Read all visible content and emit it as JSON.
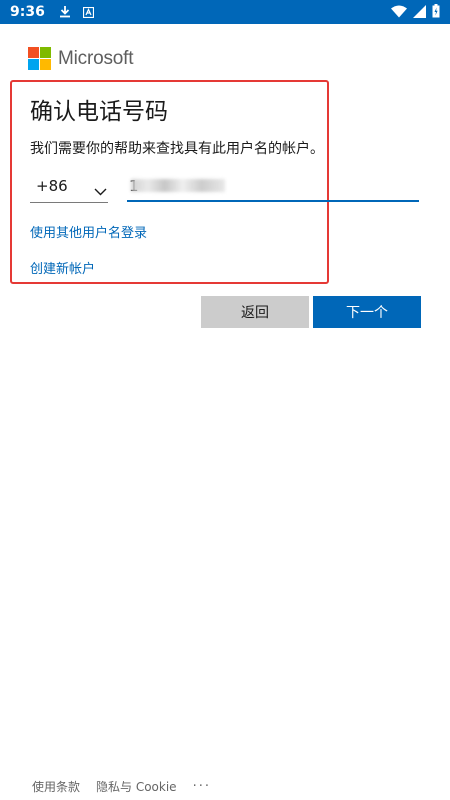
{
  "status_bar": {
    "time": "9:36",
    "bg_color": "#0067b8",
    "icons": [
      "download-icon",
      "app-notification-icon",
      "wifi-icon",
      "signal-icon",
      "battery-icon"
    ]
  },
  "brand": {
    "name": "Microsoft",
    "logo_colors": [
      "#f25022",
      "#7fba00",
      "#00a4ef",
      "#ffb900"
    ]
  },
  "form": {
    "title": "确认电话号码",
    "description": "我们需要你的帮助来查找具有此用户名的帐户。",
    "country_code": "+86",
    "phone_value": "1",
    "phone_masked": true
  },
  "links": {
    "use_other_username": "使用其他用户名登录",
    "create_account": "创建新帐户"
  },
  "buttons": {
    "back": "返回",
    "next": "下一个"
  },
  "footer": {
    "terms": "使用条款",
    "privacy": "隐私与 Cookie",
    "more": "···"
  },
  "colors": {
    "accent": "#0067b8",
    "highlight": "#e53935"
  }
}
